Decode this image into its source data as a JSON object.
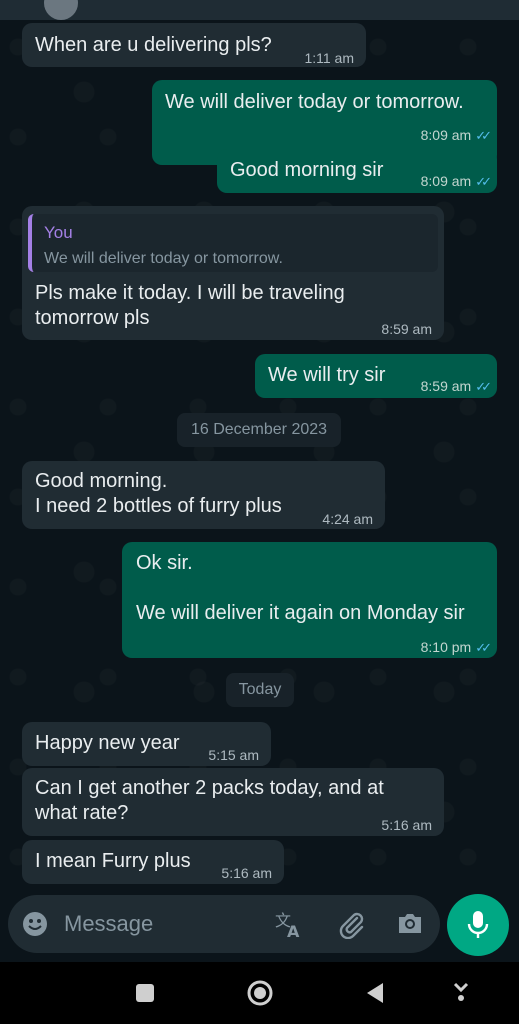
{
  "messages": [
    {
      "text": "When are u delivering pls?",
      "time": "1:11 am"
    },
    {
      "text": "We will deliver today or tomorrow.",
      "time": "8:09 am"
    },
    {
      "text": "Good morning sir",
      "time": "8:09 am"
    },
    {
      "quote_author": "You",
      "quote_text": "We will deliver today or tomorrow.",
      "line1": "Pls make it today. I will be traveling",
      "line2": "tomorrow pls",
      "time": "8:59 am"
    },
    {
      "text": "We will try sir",
      "time": "8:59 am"
    },
    {
      "line1": "Good morning.",
      "line2": "I need 2 bottles of furry plus",
      "time": "4:24 am"
    },
    {
      "line1": "Ok sir.",
      "line2": "We will deliver it again on Monday sir",
      "time": "8:10 pm"
    },
    {
      "text": "Happy new year",
      "time": "5:15 am"
    },
    {
      "line1": "Can I get another 2 packs today, and at",
      "line2": "what rate?",
      "time": "5:16 am"
    },
    {
      "text": "I mean Furry plus",
      "time": "5:16 am"
    }
  ],
  "date_separators": [
    "16 December 2023",
    "Today"
  ],
  "composer": {
    "placeholder": "Message"
  },
  "icons": [
    "emoji-icon",
    "translate-icon",
    "attach-icon",
    "camera-icon",
    "mic-icon",
    "recent-apps-icon",
    "home-icon",
    "back-icon",
    "keyboard-hide-icon",
    "read-receipt-icon"
  ],
  "colors": {
    "incoming": "#202c33",
    "outgoing": "#005c4b",
    "background": "#0b141a",
    "accent": "#00a884",
    "ticks": "#53bdeb"
  }
}
